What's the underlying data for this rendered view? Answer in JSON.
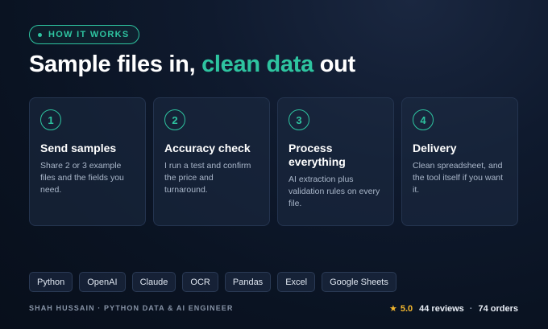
{
  "badge": {
    "label": "HOW IT WORKS"
  },
  "headline": {
    "part1": "Sample files in, ",
    "accent": "clean data",
    "part2": " out"
  },
  "steps": [
    {
      "number": "1",
      "title": "Send samples",
      "description": "Share 2 or 3 example files and the fields you need."
    },
    {
      "number": "2",
      "title": "Accuracy check",
      "description": "I run a test and confirm the price and turnaround."
    },
    {
      "number": "3",
      "title": "Process everything",
      "description": "AI extraction plus validation rules on every file."
    },
    {
      "number": "4",
      "title": "Delivery",
      "description": "Clean spreadsheet, and the tool itself if you want it."
    }
  ],
  "tags": [
    "Python",
    "OpenAI",
    "Claude",
    "OCR",
    "Pandas",
    "Excel",
    "Google Sheets"
  ],
  "footer": {
    "author": "SHAH HUSSAIN · PYTHON DATA & AI ENGINEER",
    "star": "★",
    "rating": "5.0",
    "reviews": "44 reviews",
    "separator": "·",
    "orders": "74 orders"
  },
  "colors": {
    "accent": "#2ec4a0",
    "star": "#f5b82e",
    "background": "#0a1322"
  }
}
